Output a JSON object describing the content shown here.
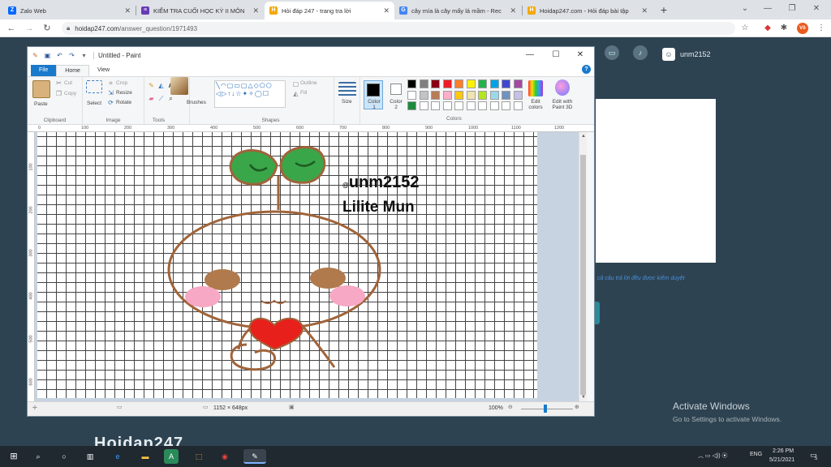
{
  "browser": {
    "tabs": [
      {
        "title": "Zalo Web",
        "fav": "zalo-icon",
        "color": "#0068ff",
        "glyph": "Z"
      },
      {
        "title": "KIỂM TRA CUỐI HỌC KỲ II MÔN",
        "fav": "form-icon",
        "color": "#673ab7",
        "glyph": "≡"
      },
      {
        "title": "Hỏi đáp 247 - trang tra lời",
        "fav": "hoidap-icon",
        "color": "#f5a800",
        "glyph": "H"
      },
      {
        "title": "cây mía là cây mấy lá mầm - Rec",
        "fav": "google-icon",
        "color": "#4285f4",
        "glyph": "G"
      },
      {
        "title": "Hoidap247.com - Hỏi đáp bài tập",
        "fav": "hoidap-icon",
        "color": "#f5a800",
        "glyph": "H"
      }
    ],
    "new_tab": "+",
    "url_host": "hoidap247.com",
    "url_path": "/answer_question/1971493",
    "profile_initials": "Vô"
  },
  "site": {
    "username": "unm2152",
    "note": "cả câu trả lời đều được kiểm duyệt",
    "activate_title": "Activate Windows",
    "activate_sub": "Go to Settings to activate Windows.",
    "logo_text": "Hoidap247"
  },
  "paint": {
    "title": "Untitled - Paint",
    "tabs": {
      "file": "File",
      "home": "Home",
      "view": "View"
    },
    "ribbon": {
      "paste": "Paste",
      "cut": "Cut",
      "copy": "Copy",
      "select": "Select",
      "crop": "Crop",
      "resize": "Resize",
      "rotate": "Rotate",
      "brushes": "Brushes",
      "outline": "Outline",
      "fill": "Fill",
      "size": "Size",
      "color1": "Color 1",
      "color2": "Color 2",
      "edit_colors": "Edit colors",
      "edit_paint3d": "Edit with Paint 3D",
      "groups": {
        "clipboard": "Clipboard",
        "image": "Image",
        "tools": "Tools",
        "shapes": "Shapes",
        "colors": "Colors"
      },
      "palette": [
        "#000000",
        "#7f7f7f",
        "#880015",
        "#ed1c24",
        "#ff7f27",
        "#fff200",
        "#22b14c",
        "#00a2e8",
        "#3f48cc",
        "#a349a4",
        "#ffffff",
        "#c3c3c3",
        "#b97a57",
        "#ffaec9",
        "#ffc90e",
        "#efe4b0",
        "#b5e61d",
        "#99d9ea",
        "#7092be",
        "#c8bfe7",
        "#1e8a3c",
        "#ffffff",
        "#ffffff",
        "#ffffff",
        "#ffffff",
        "#ffffff",
        "#ffffff",
        "#ffffff",
        "#ffffff",
        "#ffffff"
      ]
    },
    "ruler_h": [
      "0",
      "100",
      "200",
      "300",
      "400",
      "500",
      "600",
      "700",
      "800",
      "900",
      "1000",
      "1100",
      "1200"
    ],
    "ruler_v": [
      "100",
      "200",
      "300",
      "400",
      "500",
      "600"
    ],
    "drawing": {
      "handle": "@unm2152",
      "handle_at": "@",
      "handle_name": "unm2152",
      "name": "Lilite Mun",
      "colors": {
        "leaf": "#3aa64a",
        "outline": "#a0643a",
        "cheek": "#f7a8c4",
        "mouth": "#e8201c",
        "eye": "#b07a4d"
      }
    },
    "status": {
      "dimensions": "1152 × 648px",
      "zoom": "100%"
    }
  },
  "taskbar": {
    "lang": "ENG",
    "time": "2:26 PM",
    "date": "5/21/2021",
    "notif_count": "5"
  }
}
